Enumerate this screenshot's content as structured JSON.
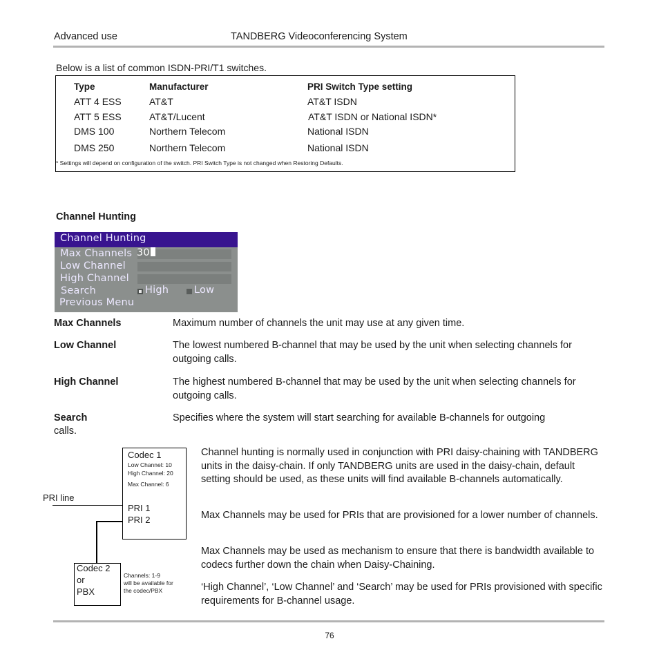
{
  "header": {
    "section": "Advanced use",
    "title": "TANDBERG Videoconferencing System"
  },
  "intro": "Below is a list of common ISDN-PRI/T1 switches.",
  "switch_table": {
    "columns": [
      "Type",
      "Manufacturer",
      "PRI Switch Type setting"
    ],
    "rows": [
      [
        "ATT 4 ESS",
        "AT&T",
        "AT&T ISDN"
      ],
      [
        "ATT 5 ESS",
        "AT&T/Lucent",
        "AT&T ISDN or National ISDN*"
      ],
      [
        "DMS 100",
        "Northern  Telecom",
        "National  ISDN"
      ],
      [
        "DMS 250",
        "Northern  Telecom",
        "National  ISDN"
      ]
    ],
    "footnote": "* Settings will depend on configuration of the switch. PRI Switch Type is not changed when Restoring Defaults."
  },
  "section_title": "Channel Hunting",
  "menu": {
    "title": "Channel Hunting",
    "items": {
      "max_channels": {
        "label": "Max Channels",
        "value": "30"
      },
      "low_channel": {
        "label": "Low Channel",
        "value": ""
      },
      "high_channel": {
        "label": "High Channel",
        "value": ""
      },
      "search": {
        "label": "Search",
        "options": [
          "High",
          "Low"
        ],
        "selected": "High"
      },
      "previous": {
        "label": "Previous Menu"
      }
    },
    "colors": {
      "title_bg": "#38148f",
      "body_bg": "#8b8f8d",
      "text": "#ece8ff"
    }
  },
  "definitions": [
    {
      "term": "Max Channels",
      "text": "Maximum number of channels the unit may use at any given time."
    },
    {
      "term": "Low Channel",
      "text": "The lowest numbered B-channel that may be used by the unit when selecting channels for outgoing calls."
    },
    {
      "term": "High Channel",
      "text": "The highest numbered B-channel that may be used by the unit when selecting channels for outgoing calls."
    },
    {
      "term": "Search",
      "text": "Specifies where the system will start searching for available B-channels for outgoing",
      "text_cont": "calls."
    }
  ],
  "diagram": {
    "codec1": {
      "title": "Codec  1",
      "low": "Low Channel: 10",
      "high": "High Channel: 20",
      "max": "Max Channel: 6",
      "pri1": "PRI 1",
      "pri2": "PRI 2"
    },
    "pri_line": "PRI  line",
    "codec2": {
      "line1": "Codec  2",
      "line2": "or",
      "line3": "PBX"
    },
    "note": [
      "Channels: 1-9",
      "will be available for",
      "the codec/PBX"
    ]
  },
  "paragraphs": [
    "Channel hunting is normally used in conjunction with PRI daisy-chaining with TANDBERG units in the daisy-chain. If only TANDBERG units are used in the daisy-chain, default setting should be used, as these units will find available B-channels automatically.",
    "Max Channels may be used for PRIs that are provisioned for a lower number of channels.",
    "Max Channels may be used as mechanism to ensure that there is bandwidth available to codecs further down the chain when Daisy-Chaining.",
    "‘High Channel’, ‘Low Channel’ and ‘Search’ may be used for PRIs provisioned with specific requirements for B-channel usage."
  ],
  "page_number": "76"
}
